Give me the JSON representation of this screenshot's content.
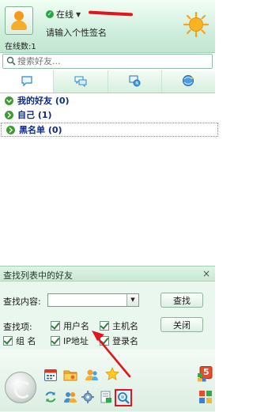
{
  "header": {
    "status": "在线",
    "signature": "请输入个性签名",
    "online_count": "在线数:1"
  },
  "search": {
    "placeholder": "搜索好友..."
  },
  "tabs": [
    {
      "name": "chat-bubble-icon"
    },
    {
      "name": "group-chat-icon"
    },
    {
      "name": "recent-contacts-icon"
    },
    {
      "name": "web-browser-icon"
    }
  ],
  "groups": [
    {
      "label": "我的好友 (0)"
    },
    {
      "label": "自己 (1)"
    },
    {
      "label": "黑名单 (0)"
    }
  ],
  "find_panel": {
    "title": "查找列表中的好友",
    "close_glyph": "×",
    "content_label": "查找内容:",
    "content_value": "",
    "find_button": "查找",
    "items_label": "查找项:",
    "close_button": "关闭",
    "options": [
      {
        "label": "用户名",
        "checked": true
      },
      {
        "label": "主机名",
        "checked": true
      },
      {
        "label": "组 名",
        "checked": true
      },
      {
        "label": "IP地址",
        "checked": true
      },
      {
        "label": "登录名",
        "checked": true
      }
    ]
  },
  "dock": {
    "badge": "5"
  },
  "colors": {
    "accent_green": "#2fa34a",
    "group_text": "#0e2a86",
    "highlight_red": "#e3141c"
  }
}
